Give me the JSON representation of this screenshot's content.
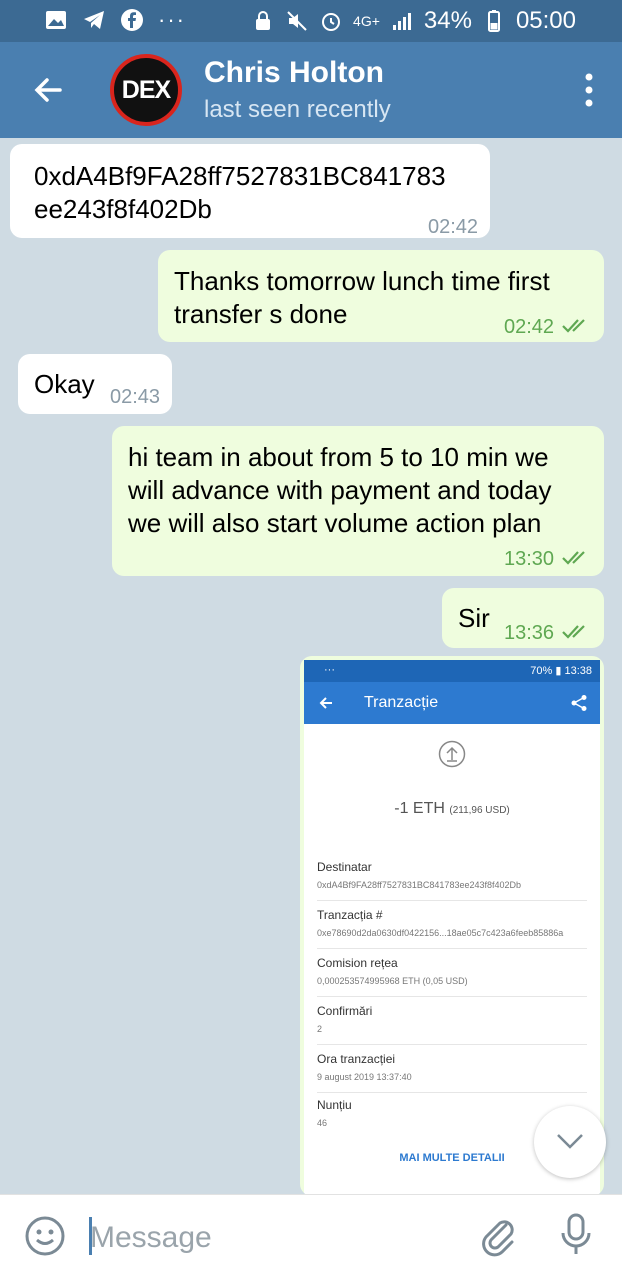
{
  "status_bar": {
    "network": "4G+",
    "battery": "34%",
    "time": "05:00",
    "more": "···"
  },
  "header": {
    "avatar_text": "DEX",
    "contact_name": "Chris Holton",
    "contact_status": "last seen recently"
  },
  "messages": [
    {
      "direction": "in",
      "text_lines": [
        "0xdA4Bf9FA28ff7527831BC841783",
        "ee243f8f402Db"
      ],
      "time": "02:42"
    },
    {
      "direction": "out",
      "text_lines": [
        "Thanks tomorrow lunch time first",
        "transfer s done"
      ],
      "time": "02:42",
      "read": true
    },
    {
      "direction": "in",
      "text_lines": [
        "Okay"
      ],
      "time": "02:43"
    },
    {
      "direction": "out",
      "text_lines": [
        "hi team in about from 5 to 10 min we",
        "will advance with payment and today",
        "we will also start volume action plan"
      ],
      "time": "13:30",
      "read": true
    },
    {
      "direction": "out",
      "text_lines": [
        "Sir"
      ],
      "time": "13:36",
      "read": true
    }
  ],
  "screenshot": {
    "status_left": "··· ",
    "status_right": "70% ▮ 13:38",
    "title": "Tranzacție",
    "amount": "-1 ETH",
    "amount_usd": "(211,96 USD)",
    "fields": [
      {
        "label": "Destinatar",
        "value": "0xdA4Bf9FA28ff7527831BC841783ee243f8f402Db"
      },
      {
        "label": "Tranzacția #",
        "value": "0xe78690d2da0630df0422156...18ae05c7c423a6feeb85886a"
      },
      {
        "label": "Comision rețea",
        "value": "0,000253574995968 ETH (0,05 USD)"
      },
      {
        "label": "Confirmări",
        "value": "2"
      },
      {
        "label": "Ora tranzacției",
        "value": "9 august 2019 13:37:40"
      },
      {
        "label": "Nunțiu",
        "value": "46"
      }
    ],
    "more_link": "MAI MULTE DETALII"
  },
  "input": {
    "placeholder": "Message"
  },
  "colors": {
    "header": "#4a7fb0",
    "status_bar": "#3c6a93",
    "outgoing_bubble": "#effdde",
    "incoming_bubble": "#ffffff",
    "chat_bg": "#cfdbe3",
    "read_check": "#5fa852"
  }
}
